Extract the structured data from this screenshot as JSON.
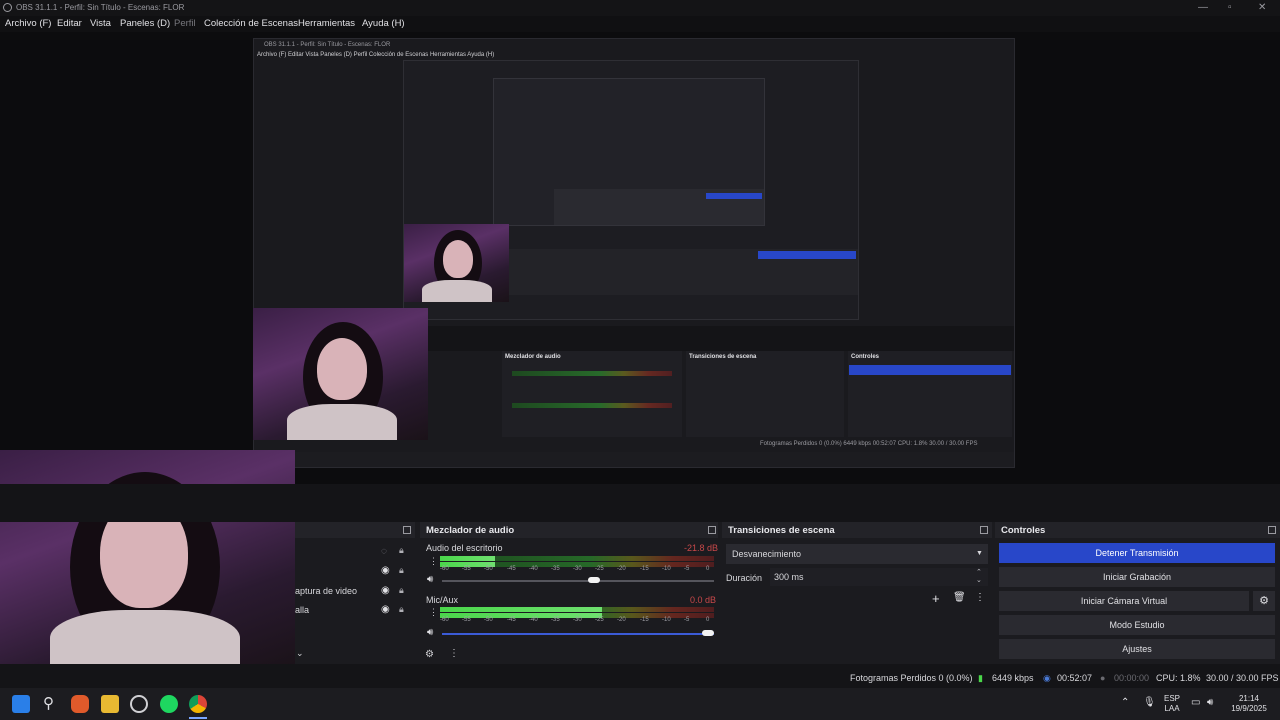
{
  "window": {
    "title": "OBS 31.1.1 - Perfil: Sin Título - Escenas: FLOR"
  },
  "menu": [
    {
      "label": "Archivo (F)"
    },
    {
      "label": "Editar"
    },
    {
      "label": "Vista"
    },
    {
      "label": "Paneles (D)"
    },
    {
      "label": "Perfil"
    },
    {
      "label": "Colección de Escenas"
    },
    {
      "label": "Herramientas"
    },
    {
      "label": "Ayuda (H)"
    }
  ],
  "sources": {
    "items": [
      "aptura de video",
      "alla"
    ]
  },
  "audio_mixer": {
    "title": "Mezclador de audio",
    "scale": [
      "-60",
      "-55",
      "-50",
      "-45",
      "-40",
      "-35",
      "-30",
      "-25",
      "-20",
      "-15",
      "-10",
      "-5",
      "0"
    ],
    "channels": [
      {
        "name": "Audio del escritorio",
        "db": "-21.8 dB",
        "level": 0.2,
        "volume": 0.56
      },
      {
        "name": "Mic/Aux",
        "db": "0.0 dB",
        "level": 0.59,
        "volume": 1.0
      }
    ]
  },
  "transitions": {
    "title": "Transiciones de escena",
    "selected": "Desvanecimiento",
    "duration_label": "Duración",
    "duration_value": "300 ms"
  },
  "controls": {
    "title": "Controles",
    "buttons": [
      "Detener Transmisión",
      "Iniciar Grabación",
      "Iniciar Cámara Virtual",
      "Modo Estudio",
      "Ajustes"
    ]
  },
  "status": {
    "dropped": "Fotogramas Perdidos 0 (0.0%)",
    "bitrate": "6449 kbps",
    "stream_time": "00:52:07",
    "rec_time": "00:00:00",
    "cpu": "CPU: 1.8%",
    "fps": "30.00 / 30.00 FPS"
  },
  "taskbar": {
    "lang_top": "ESP",
    "lang_bottom": "LAA",
    "time": "21:14",
    "date": "19/9/2025"
  },
  "nested_preview": {
    "title": "OBS 31.1.1 - Perfil: Sin Título - Escenas: FLOR",
    "menu": "Archivo (F)   Editar   Vista   Paneles (D)   Perfil   Colección de Escenas   Herramientas   Ayuda (H)",
    "audio_title": "Mezclador de audio",
    "trans_title": "Transiciones de escena",
    "ctrl_title": "Controles",
    "status": "Fotogramas Perdidos 0 (0.0%)   6449 kbps   00:52:07   CPU: 1.8%   30.00 / 30.00 FPS"
  },
  "colors": {
    "accent": "#2847c9",
    "panel": "#1b1b1f",
    "meter_green": "#4ad64a"
  }
}
